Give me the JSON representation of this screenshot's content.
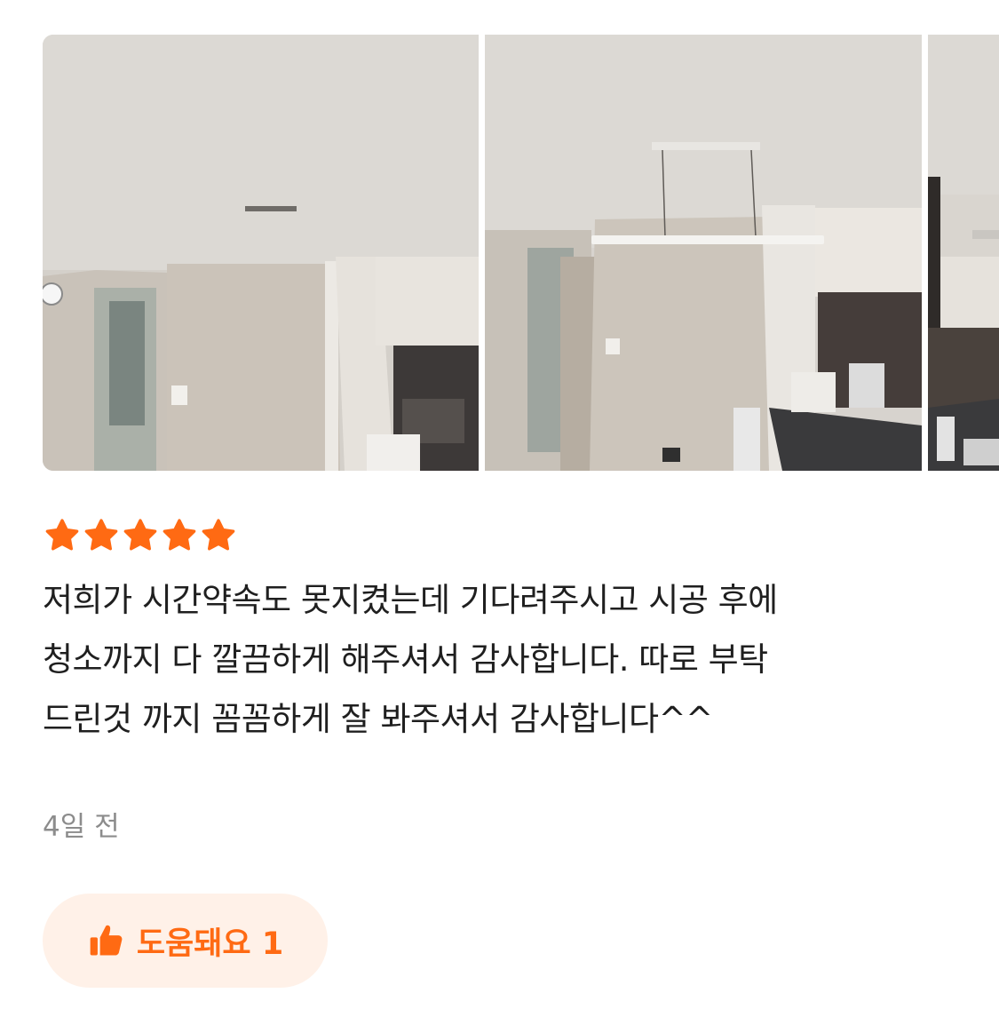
{
  "gallery": {
    "photos": [
      {
        "icon": "ceiling-before-photo"
      },
      {
        "icon": "ceiling-light-installed-photo"
      },
      {
        "icon": "kitchen-partial-photo"
      }
    ]
  },
  "rating": {
    "value": 5,
    "max": 5,
    "color": "#ff6a13"
  },
  "review": {
    "lines": [
      "저희가 시간약속도 못지켰는데 기다려주시고 시공 후에",
      "청소까지 다 깔끔하게 해주셔서 감사합니다. 따로 부탁",
      "드린것 까지 꼼꼼하게 잘 봐주셔서 감사합니다^^"
    ]
  },
  "timestamp": "4일 전",
  "helpful": {
    "label": "도움돼요 1",
    "icon": "thumbs-up-icon",
    "color": "#ff6a13",
    "background": "#fff1e8"
  }
}
